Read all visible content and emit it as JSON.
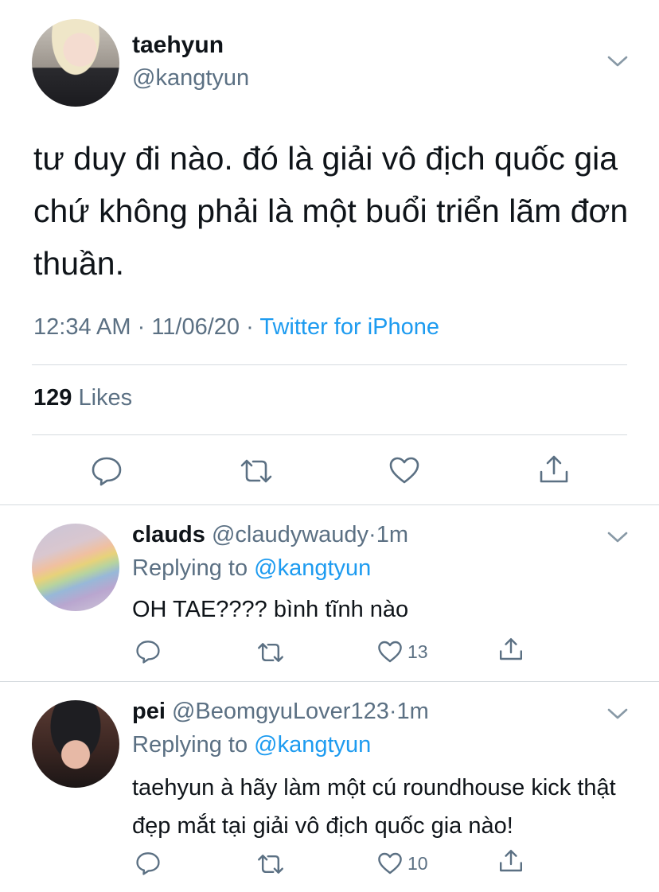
{
  "main_tweet": {
    "display_name": "taehyun",
    "handle": "@kangtyun",
    "text": "tư duy đi nào. đó là giải vô địch quốc gia chứ không phải là một buổi triển lãm đơn thuần.",
    "time": "12:34 AM",
    "date": "11/06/20",
    "separator": "·",
    "source": "Twitter for iPhone",
    "likes_count": "129",
    "likes_label": "Likes"
  },
  "replies": [
    {
      "display_name": "clauds",
      "handle": "@claudywaudy",
      "separator": "·",
      "time_ago": "1m",
      "replying_label": "Replying to",
      "replying_to": "@kangtyun",
      "text": "OH TAE???? bình tĩnh nào",
      "like_count": "13"
    },
    {
      "display_name": "pei",
      "handle": "@BeomgyuLover123",
      "separator": "·",
      "time_ago": "1m",
      "replying_label": "Replying to",
      "replying_to": "@kangtyun",
      "text": "taehyun à hãy làm một cú roundhouse kick thật đẹp mắt tại giải vô địch quốc gia nào!",
      "like_count": "10"
    }
  ],
  "icons": {
    "reply": "comment-icon",
    "retweet": "retweet-icon",
    "like": "heart-icon",
    "share": "share-icon",
    "more": "chevron-down-icon"
  },
  "colors": {
    "accent": "#1d9bf0",
    "secondary_text": "#5b7083",
    "primary_text": "#0f1419",
    "divider": "#d5dadf"
  }
}
